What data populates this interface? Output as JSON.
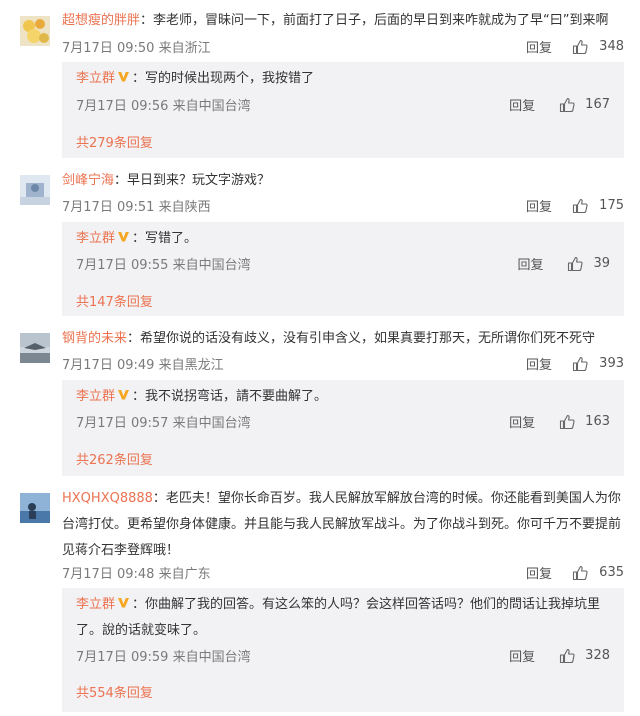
{
  "comments": [
    {
      "user": "超想瘦的胖胖",
      "text": "：李老师，冒昧问一下，前面打了日子，后面的早日到来咋就成为了早“曰”到来啊",
      "time": "7月17日 09:50",
      "location": "来自浙江",
      "reply_label": "回复",
      "likes": "348",
      "reply": {
        "user": "李立群",
        "text": "：写的时候出现两个，我按错了",
        "time": "7月17日 09:56",
        "location": "来自中国台湾",
        "reply_label": "回复",
        "likes": "167"
      },
      "more": "共279条回复"
    },
    {
      "user": "剑峰宁海",
      "text": "：早日到来？玩文字游戏？",
      "time": "7月17日 09:51",
      "location": "来自陕西",
      "reply_label": "回复",
      "likes": "175",
      "reply": {
        "user": "李立群",
        "text": "：写错了。",
        "time": "7月17日 09:55",
        "location": "来自中国台湾",
        "reply_label": "回复",
        "likes": "39"
      },
      "more": "共147条回复"
    },
    {
      "user": "钢背的未来",
      "text": "：希望你说的话没有歧义，没有引申含义，如果真要打那天，无所谓你们死不死守",
      "time": "7月17日 09:49",
      "location": "来自黑龙江",
      "reply_label": "回复",
      "likes": "393",
      "reply": {
        "user": "李立群",
        "text": "：我不说拐弯话，請不要曲解了。",
        "time": "7月17日 09:57",
        "location": "来自中国台湾",
        "reply_label": "回复",
        "likes": "163"
      },
      "more": "共262条回复"
    },
    {
      "user": "HXQHXQ8888",
      "text_lines": [
        "：老匹夫！望你长命百岁。我人民解放军解放台湾的时候。你还能看到美国人为你",
        "台湾打仗。更希望你身体健康。并且能与我人民解放军战斗。为了你战斗到死。你可千万不要提前",
        "见蒋介石李登辉哦！"
      ],
      "time": "7月17日 09:48",
      "location": "来自广东",
      "reply_label": "回复",
      "likes": "635",
      "reply": {
        "user": "李立群",
        "text_lines": [
          "：你曲解了我的回答。有这么笨的人吗？会这样回答话吗？他们的問话让我掉坑里",
          "了。說的话就变味了。"
        ],
        "time": "7月17日 09:59",
        "location": "来自中国台湾",
        "reply_label": "回复",
        "likes": "328"
      },
      "more": "共554条回复"
    }
  ],
  "colors": {
    "username": "#eb7350",
    "meta": "#7a7a7a",
    "reply_bg": "#f2f2f5",
    "badge": "#f5a623"
  },
  "icons": {
    "like": "thumbs-up-icon",
    "badge": "verified-v-icon"
  }
}
